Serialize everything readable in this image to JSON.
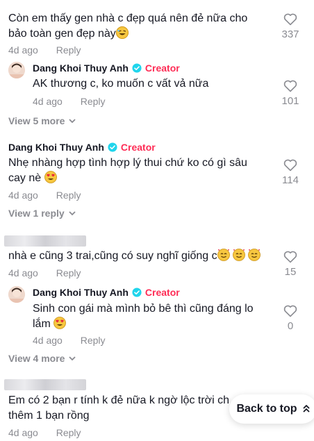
{
  "comments": [
    {
      "text_line1": "Còn em thấy gen nhà c đẹp quá nên đẻ nữa cho",
      "text_line2": "bảo toàn gen đẹp này",
      "emoji": "laughing-emoji",
      "time": "4d ago",
      "reply_label": "Reply",
      "likes": "337",
      "reply": {
        "author": "Dang Khoi Thuy Anh",
        "badge": "Creator",
        "text": "AK thương c, ko muốn c vất vả nữa",
        "time": "4d ago",
        "reply_label": "Reply",
        "likes": "101"
      },
      "view_more": "View 5 more"
    },
    {
      "author": "Dang Khoi Thuy Anh",
      "badge": "Creator",
      "text_line1": "Nhẹ nhàng hợp tình hợp lý thui chứ ko có gì sâu",
      "text_line2": "cay nè",
      "emoji": "heart-eyes-emoji",
      "time": "4d ago",
      "reply_label": "Reply",
      "likes": "114",
      "view_more": "View 1 reply"
    },
    {
      "text_line1": "nhà e cũng 3 trai,cũng có suy nghĩ giống c",
      "emoji": "smiling-hearts-emoji",
      "time": "4d ago",
      "reply_label": "Reply",
      "likes": "15",
      "reply": {
        "author": "Dang Khoi Thuy Anh",
        "badge": "Creator",
        "text_line1": "Sinh con gái mà mình bỏ bê thì cũng đáng lo",
        "text_line2": "lắm",
        "emoji": "heart-eyes-emoji",
        "time": "4d ago",
        "reply_label": "Reply",
        "likes": "0"
      },
      "view_more": "View 4 more"
    },
    {
      "text_line1": "Em có 2 bạn r tính k đẻ nữa k ngờ lộc trời ch",
      "text_line2": "thêm 1 bạn rồng",
      "time": "4d ago",
      "reply_label": "Reply"
    }
  ],
  "back_to_top": "Back to top",
  "colors": {
    "creator": "#fe2c55",
    "meta": "#8a8b91",
    "text": "#161823",
    "verified": "#20d5ec"
  }
}
